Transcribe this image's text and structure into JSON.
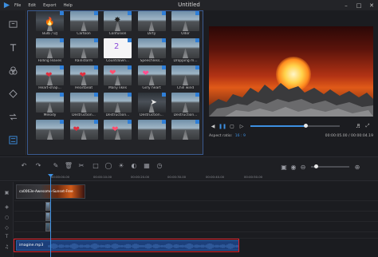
{
  "window": {
    "title": "Untitled",
    "controls": [
      "minimize-icon",
      "maximize-icon",
      "close-icon"
    ]
  },
  "menu": [
    "File",
    "Edit",
    "Export",
    "Help"
  ],
  "sidebar": [
    "media-icon",
    "text-icon",
    "filters-icon",
    "overlays-icon",
    "transitions-icon",
    "effects-icon"
  ],
  "effects": [
    {
      "label": "Bulb / DJ",
      "style": "dark"
    },
    {
      "label": "Cartoon",
      "style": "road"
    },
    {
      "label": "Confusion",
      "style": "road"
    },
    {
      "label": "Dirty",
      "style": "road"
    },
    {
      "label": "Odor",
      "style": "road"
    },
    {
      "label": "Falling leaves",
      "style": "road"
    },
    {
      "label": "Rainstorm",
      "style": "road"
    },
    {
      "label": "Countdown...",
      "style": "white"
    },
    {
      "label": "Speechless...",
      "style": "road"
    },
    {
      "label": "Dropping m...",
      "style": "road"
    },
    {
      "label": "Heart-shap...",
      "style": "road"
    },
    {
      "label": "Heartbeat",
      "style": "road"
    },
    {
      "label": "Many likes",
      "style": "road"
    },
    {
      "label": "Girly heart",
      "style": "road"
    },
    {
      "label": "Chill wind",
      "style": "road"
    },
    {
      "label": "Melody",
      "style": "road"
    },
    {
      "label": "Destruction...",
      "style": "road"
    },
    {
      "label": "Destruction...",
      "style": "road"
    },
    {
      "label": "Destruction...",
      "style": "dark"
    },
    {
      "label": "Destruction...",
      "style": "road"
    },
    {
      "label": "",
      "style": "road"
    },
    {
      "label": "",
      "style": "road"
    },
    {
      "label": "",
      "style": "road"
    },
    {
      "label": "",
      "style": "road"
    },
    {
      "label": "",
      "style": "road"
    }
  ],
  "preview": {
    "aspect_label": "Aspect ratio:",
    "aspect_value": "16 : 9",
    "timecode": "00:00:05.00 / 00:00:04.19",
    "progress": 0.62
  },
  "ruler": [
    "00:00:00.00",
    "00:00:10.00",
    "00:00:20.00",
    "00:00:30.00",
    "00:00:40.00",
    "00:00:50.00"
  ],
  "timeline": {
    "video_clip": "ca0063e-Awesome-Sunset-Free",
    "audio_clip": "imagine.mp3"
  },
  "colors": {
    "accent": "#3d8fe0",
    "highlight": "#e0202a",
    "audio": "#1c3f7a"
  }
}
